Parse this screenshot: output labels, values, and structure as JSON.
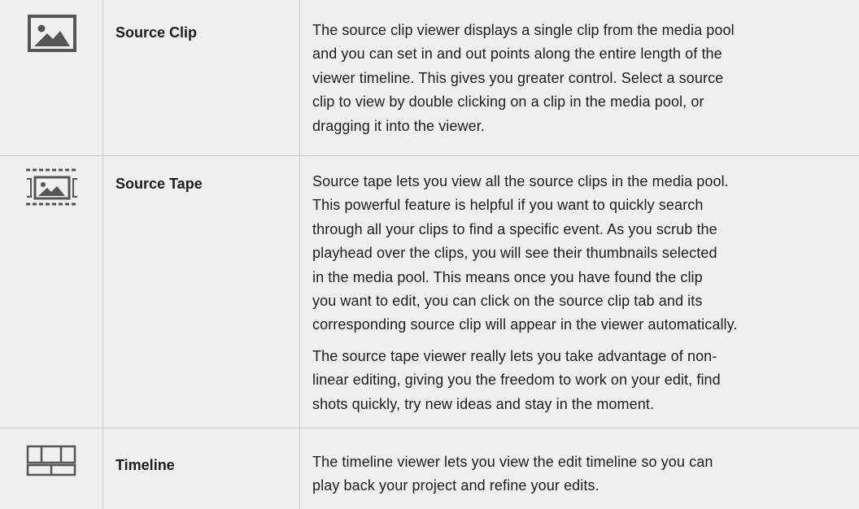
{
  "rows": [
    {
      "icon": "image-icon",
      "title": "Source Clip",
      "paragraphs": [
        "The source clip viewer displays a single clip from the media pool\nand you can set in and out points along the entire length of the\nviewer timeline. This gives you greater control. Select a source\nclip to view by double clicking on a clip in the media pool, or\ndragging it into the viewer."
      ]
    },
    {
      "icon": "film-strip-image-icon",
      "title": "Source Tape",
      "paragraphs": [
        "Source tape lets you view all the source clips in the media pool.\nThis powerful feature is helpful if you want to quickly search\nthrough all your clips to find a specific event. As you scrub the\nplayhead over the clips, you will see their thumbnails selected\nin the media pool. This means once you have found the clip\nyou want to edit, you can click on the source clip tab and its\ncorresponding source clip will appear in the viewer automatically.",
        "The source tape viewer really lets you take advantage of non-\nlinear editing, giving you the freedom to work on your edit, find\nshots quickly, try new ideas and stay in the moment."
      ]
    },
    {
      "icon": "timeline-icon",
      "title": "Timeline",
      "paragraphs": [
        "The timeline viewer lets you view the edit timeline so you can\nplay back your project and refine your edits."
      ]
    }
  ],
  "colors": {
    "background": "#efefef",
    "text": "#1d1d1d",
    "rule": "#c9c9c9",
    "icon": "#555555"
  }
}
